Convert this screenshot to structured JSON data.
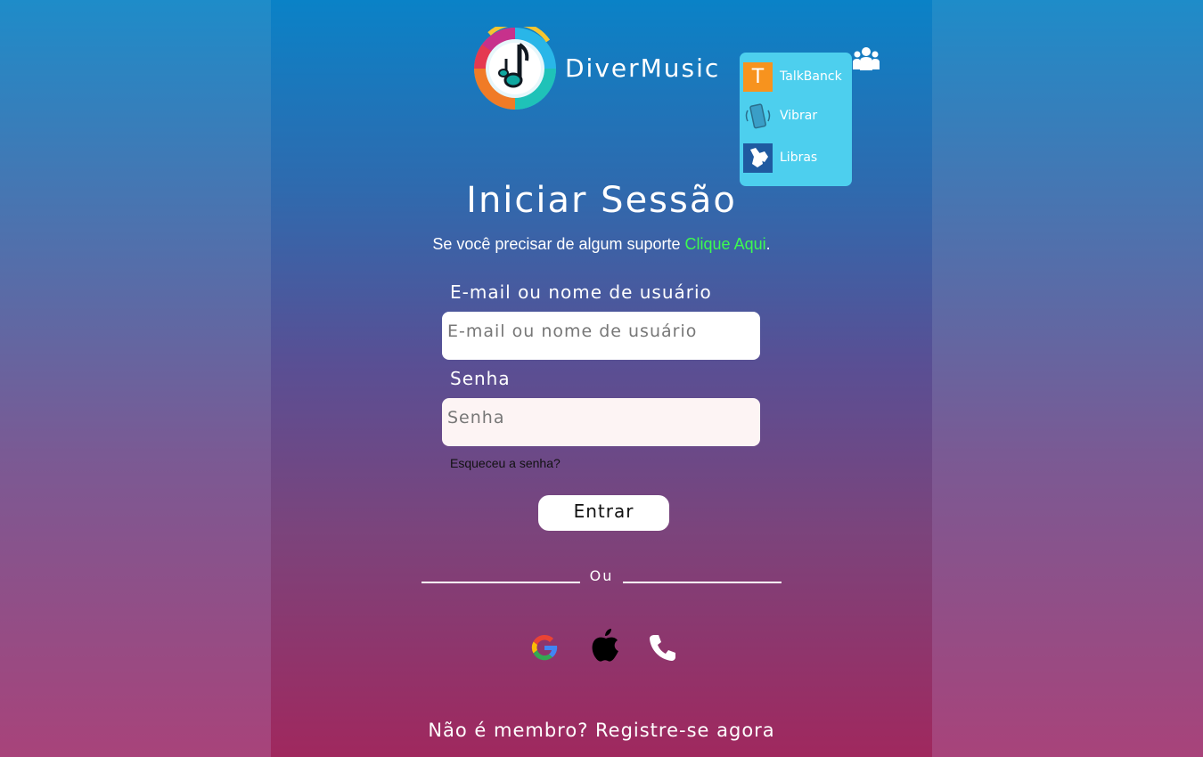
{
  "brand": {
    "name": "DiverMusic"
  },
  "accessibility": {
    "items": [
      {
        "icon": "talkback-icon",
        "glyph": "T",
        "label": "TalkBanck"
      },
      {
        "icon": "vibrate-icon",
        "label": "Vibrar"
      },
      {
        "icon": "sign-language-icon",
        "label": "Libras"
      }
    ],
    "people_icon": "people-icon"
  },
  "login": {
    "title": "Iniciar Sessão",
    "support_text": "Se você precisar de algum suporte ",
    "support_link": "Clique Aqui",
    "support_end": ".",
    "email_label": "E-mail ou nome de usuário",
    "email_placeholder": "E-mail ou nome de usuário",
    "password_label": "Senha",
    "password_placeholder": "Senha",
    "forgot": "Esqueceu a senha?",
    "submit": "Entrar",
    "or": "Ou",
    "register": "Não é membro? Registre-se agora"
  },
  "social": [
    "google-icon",
    "apple-icon",
    "phone-icon"
  ],
  "colors": {
    "accent_link": "#3dfc4f",
    "a11y_panel": "#4dcfee",
    "password_bg": "#fdf4f4",
    "talkback_bg": "#f7931e",
    "libras_bg": "#1f5aa0"
  }
}
